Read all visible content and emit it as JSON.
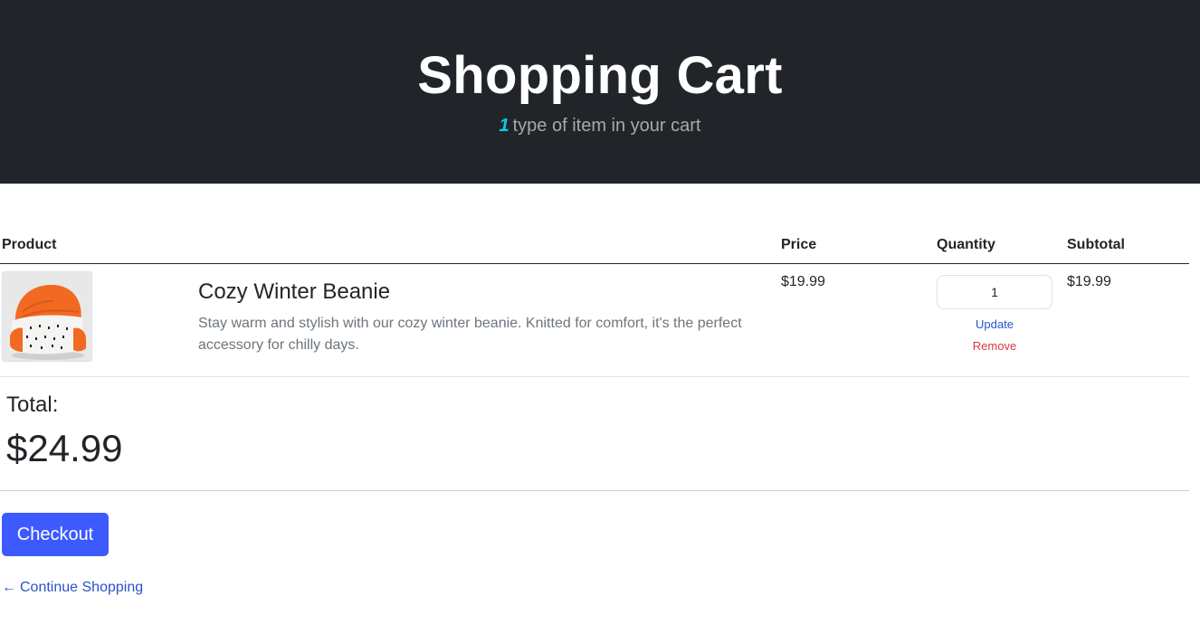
{
  "header": {
    "title": "Shopping Cart",
    "item_count": "1",
    "subtitle": "type of item in your cart"
  },
  "table": {
    "headers": {
      "product": "Product",
      "price": "Price",
      "quantity": "Quantity",
      "subtotal": "Subtotal"
    },
    "rows": [
      {
        "name": "Cozy Winter Beanie",
        "description": "Stay warm and stylish with our cozy winter beanie. Knitted for comfort, it's the perfect accessory for chilly days.",
        "price": "$19.99",
        "quantity": "1",
        "subtotal": "$19.99",
        "update_label": "Update",
        "remove_label": "Remove"
      }
    ]
  },
  "summary": {
    "total_label": "Total:",
    "total_value": "$24.99"
  },
  "actions": {
    "checkout_label": "Checkout",
    "continue_label": "Continue Shopping",
    "continue_arrow": "←"
  },
  "colors": {
    "header_bg": "#212529",
    "accent_count": "#0dcaf0",
    "primary": "#3d5afe",
    "link": "#2952cc",
    "danger": "#dc3545"
  }
}
